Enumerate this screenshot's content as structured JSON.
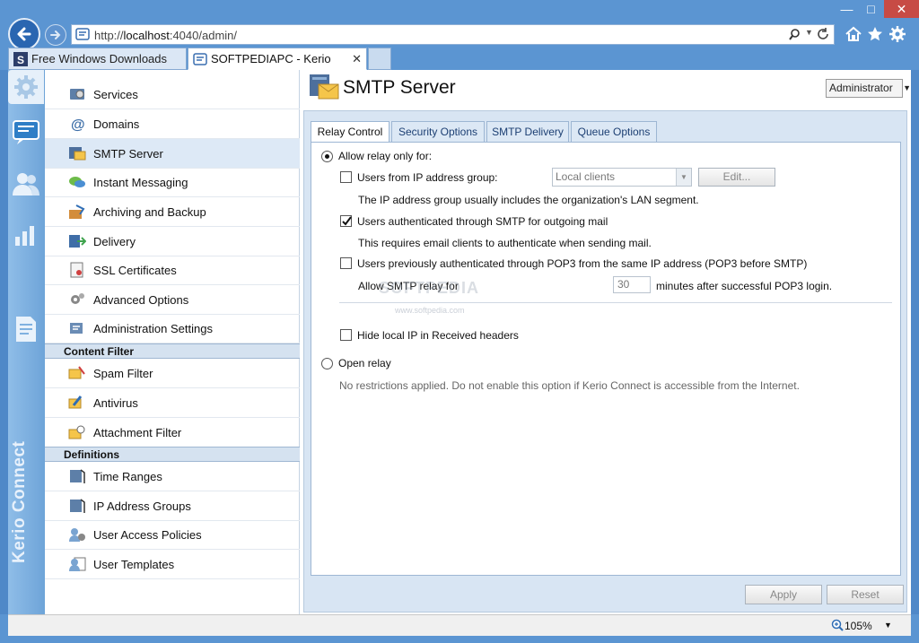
{
  "browser": {
    "window_controls": {
      "minimize": "—",
      "maximize": "□",
      "close": "✕"
    },
    "address": {
      "prefix": "http://",
      "host": "localhost",
      "path": ":4040/admin/"
    },
    "tabs": [
      {
        "label": "Free Windows Downloads",
        "icon": "softpedia-icon"
      },
      {
        "label": "SOFTPEDIAPC - Kerio Conn...",
        "icon": "kerio-favicon",
        "close": "✕"
      }
    ],
    "status": {
      "zoom": "105%"
    }
  },
  "rail": {
    "brand": "Kerio Connect"
  },
  "nav": {
    "items": [
      {
        "label": "Services"
      },
      {
        "label": "Domains"
      },
      {
        "label": "SMTP Server"
      },
      {
        "label": "Instant Messaging"
      },
      {
        "label": "Archiving and Backup"
      },
      {
        "label": "Delivery"
      },
      {
        "label": "SSL Certificates"
      },
      {
        "label": "Advanced Options"
      },
      {
        "label": "Administration Settings"
      }
    ],
    "content_filter": {
      "heading": "Content Filter",
      "items": [
        {
          "label": "Spam Filter"
        },
        {
          "label": "Antivirus"
        },
        {
          "label": "Attachment Filter"
        }
      ]
    },
    "definitions": {
      "heading": "Definitions",
      "items": [
        {
          "label": "Time Ranges"
        },
        {
          "label": "IP Address Groups"
        },
        {
          "label": "User Access Policies"
        },
        {
          "label": "User Templates"
        }
      ]
    }
  },
  "page": {
    "title": "SMTP Server",
    "user_menu": "Administrator",
    "tabs": [
      "Relay Control",
      "Security Options",
      "SMTP Delivery",
      "Queue Options"
    ],
    "relay": {
      "allow_relay_label": "Allow relay only for:",
      "allow_relay_selected": true,
      "ip_group_label": "Users from IP address group:",
      "ip_group_checked": false,
      "ip_group_value": "Local clients",
      "edit_button": "Edit...",
      "ip_group_hint": "The IP address group usually includes the organization's LAN segment.",
      "smtp_auth_label": "Users authenticated through SMTP for outgoing mail",
      "smtp_auth_checked": true,
      "smtp_auth_hint": "This requires email clients to authenticate when sending mail.",
      "pop3_label": "Users previously authenticated through POP3 from the same IP address (POP3 before SMTP)",
      "pop3_checked": false,
      "pop3_relay_prefix": "Allow SMTP relay for",
      "pop3_minutes": "30",
      "pop3_relay_suffix": "minutes after successful POP3 login.",
      "hide_ip_label": "Hide local IP in Received headers",
      "hide_ip_checked": false,
      "open_relay_label": "Open relay",
      "open_relay_selected": false,
      "open_relay_hint": "No restrictions applied. Do not enable this option if Kerio Connect is accessible from the Internet."
    },
    "buttons": {
      "apply": "Apply",
      "reset": "Reset"
    }
  },
  "watermark": {
    "main": "SOFTPEDIA",
    "sub": "www.softpedia.com"
  },
  "colors": {
    "chrome": "#5b95d2",
    "close": "#c74b45",
    "rail": "#7fb1e0",
    "active_nav": "#dde9f6"
  }
}
